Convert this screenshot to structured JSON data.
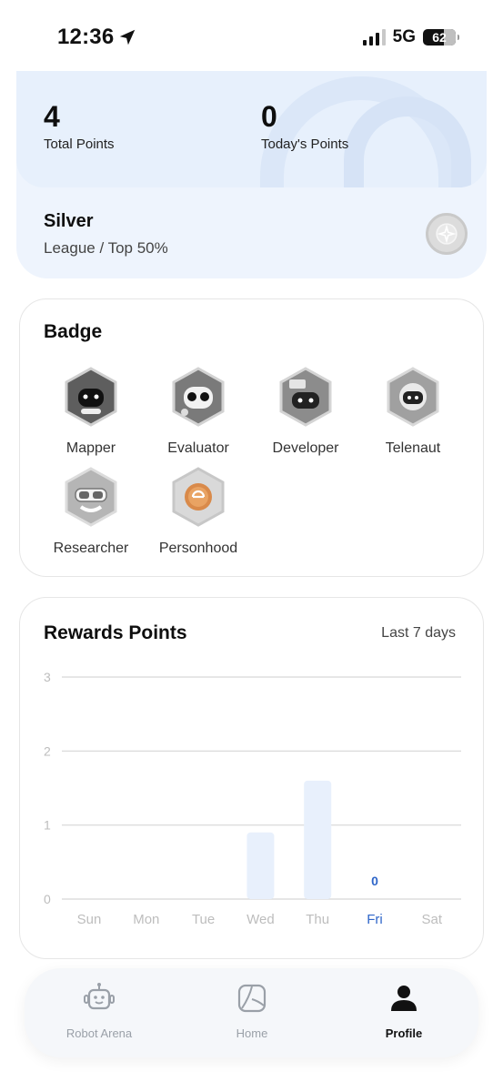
{
  "status_bar": {
    "time": "12:36",
    "network": "5G",
    "battery": "62"
  },
  "points": {
    "total_value": "4",
    "total_label": "Total Points",
    "today_value": "0",
    "today_label": "Today's Points"
  },
  "league": {
    "name": "Silver",
    "subtitle": "League / Top 50%"
  },
  "badge_section": {
    "title": "Badge",
    "items": [
      {
        "label": "Mapper",
        "icon": "mapper-badge-icon"
      },
      {
        "label": "Evaluator",
        "icon": "evaluator-badge-icon"
      },
      {
        "label": "Developer",
        "icon": "developer-badge-icon"
      },
      {
        "label": "Telenaut",
        "icon": "telenaut-badge-icon"
      },
      {
        "label": "Researcher",
        "icon": "researcher-badge-icon"
      },
      {
        "label": "Personhood",
        "icon": "personhood-badge-icon"
      }
    ]
  },
  "rewards": {
    "title": "Rewards Points",
    "range": "Last 7 days"
  },
  "chart_data": {
    "type": "bar",
    "categories": [
      "Sun",
      "Mon",
      "Tue",
      "Wed",
      "Thu",
      "Fri",
      "Sat"
    ],
    "values": [
      0,
      0,
      0,
      0.9,
      1.6,
      0,
      0
    ],
    "highlight_category": "Fri",
    "highlight_value_label": "0",
    "y_ticks": [
      "0",
      "1",
      "2",
      "3"
    ],
    "ylim": [
      0,
      3
    ],
    "grid": true,
    "colors": {
      "bar": "#e8f0fc",
      "highlight": "#2f66c9",
      "axis_text": "#bdbdbd"
    }
  },
  "tabbar": {
    "items": [
      {
        "label": "Robot Arena",
        "icon": "robot-icon",
        "active": false
      },
      {
        "label": "Home",
        "icon": "home-icon",
        "active": false
      },
      {
        "label": "Profile",
        "icon": "profile-icon",
        "active": true
      }
    ]
  }
}
